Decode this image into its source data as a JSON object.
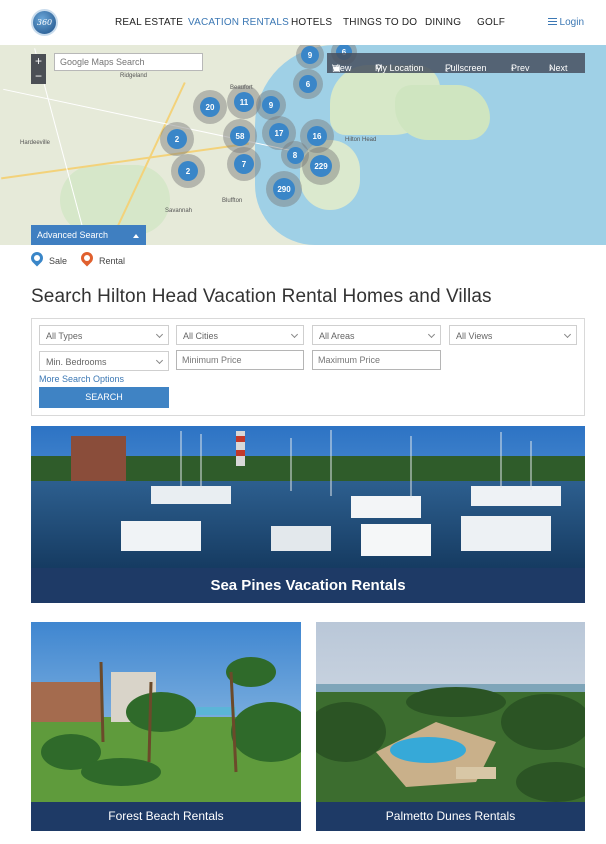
{
  "header": {
    "logo_text": "360",
    "nav": [
      "REAL ESTATE",
      "VACATION RENTALS",
      "HOTELS",
      "THINGS TO DO",
      "DINING",
      "GOLF"
    ],
    "active_nav": "VACATION RENTALS",
    "login_label": "Login"
  },
  "map": {
    "zoom_in": "+",
    "zoom_out": "−",
    "search_placeholder": "Google Maps Search",
    "tools": {
      "view": "View",
      "my_location": "My Location",
      "fullscreen": "Fullscreen",
      "prev": "Prev",
      "next": "Next"
    },
    "clusters": [
      "9",
      "6",
      "6",
      "20",
      "11",
      "9",
      "58",
      "17",
      "16",
      "2",
      "8",
      "7",
      "229",
      "2",
      "290"
    ],
    "place_labels": [
      "Bluffton",
      "Hilton Head",
      "Savannah",
      "Ridgeland",
      "Hardeeville",
      "Beaufort"
    ],
    "advanced_search_label": "Advanced Search"
  },
  "legend": {
    "sale": "Sale",
    "rental": "Rental",
    "sale_color": "#3a86c8",
    "rental_color": "#e0602e"
  },
  "page_title": "Search Hilton Head Vacation Rental Homes and Villas",
  "search_form": {
    "types": "All Types",
    "cities": "All Cities",
    "areas": "All Areas",
    "views": "All Views",
    "bedrooms": "Min. Bedrooms",
    "min_price_placeholder": "Minimum Price",
    "max_price_placeholder": "Maximum Price",
    "more_options": "More Search Options",
    "search_button": "SEARCH"
  },
  "cards": [
    {
      "title": "Sea Pines Vacation Rentals"
    },
    {
      "title": "Forest Beach Rentals"
    },
    {
      "title": "Palmetto Dunes Rentals"
    }
  ],
  "colors": {
    "accent": "#3c78b4",
    "caption_bg": "#1e3a66",
    "button_bg": "#3f83c4"
  }
}
